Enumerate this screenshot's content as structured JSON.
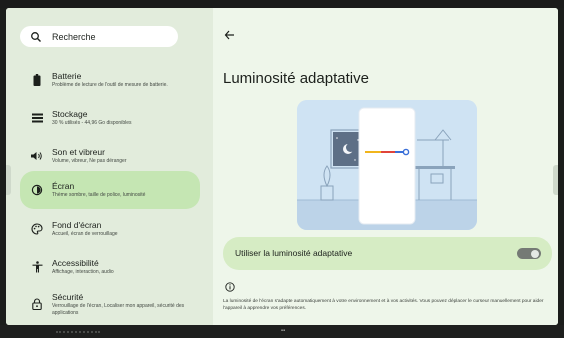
{
  "search": {
    "label": "Recherche",
    "icon": "search-icon"
  },
  "sidebar": {
    "items": [
      {
        "title": "Batterie",
        "subtitle": "Problème de lecture de l'outil de mesure de batterie.",
        "icon": "battery-icon"
      },
      {
        "title": "Stockage",
        "subtitle": "30 % utilisés - 44,96 Go disponibles",
        "icon": "storage-icon"
      },
      {
        "title": "Son et vibreur",
        "subtitle": "Volume, vibreur, Ne pas déranger",
        "icon": "sound-icon"
      },
      {
        "title": "Écran",
        "subtitle": "Thème sombre, taille de police, luminosité",
        "icon": "display-icon",
        "active": true
      },
      {
        "title": "Fond d'écran",
        "subtitle": "Accueil, écran de verrouillage",
        "icon": "palette-icon"
      },
      {
        "title": "Accessibilité",
        "subtitle": "Affichage, interaction, audio",
        "icon": "accessibility-icon"
      },
      {
        "title": "Sécurité",
        "subtitle": "Verrouillage de l'écran, Localiser mon appareil, sécurité des applications",
        "icon": "lock-icon"
      }
    ]
  },
  "main": {
    "title": "Luminosité adaptative",
    "toggle_label": "Utiliser la luminosité adaptative",
    "toggle_on": false,
    "description": "La luminosité de l'écran s'adapte automatiquement à votre environnement et à vos activités. Vous pouvez déplacer le curseur manuellement pour aider l'appareil à apprendre vos préférences."
  },
  "colors": {
    "sidebar_bg": "#e2ecdc",
    "active_item_bg": "#c5e6b3",
    "main_bg": "#eef6ea",
    "toggle_row_bg": "#d6ecc4",
    "slider_blue": "#3a6fd8",
    "slider_red": "#e0443a",
    "slider_yellow": "#f1b51c"
  }
}
